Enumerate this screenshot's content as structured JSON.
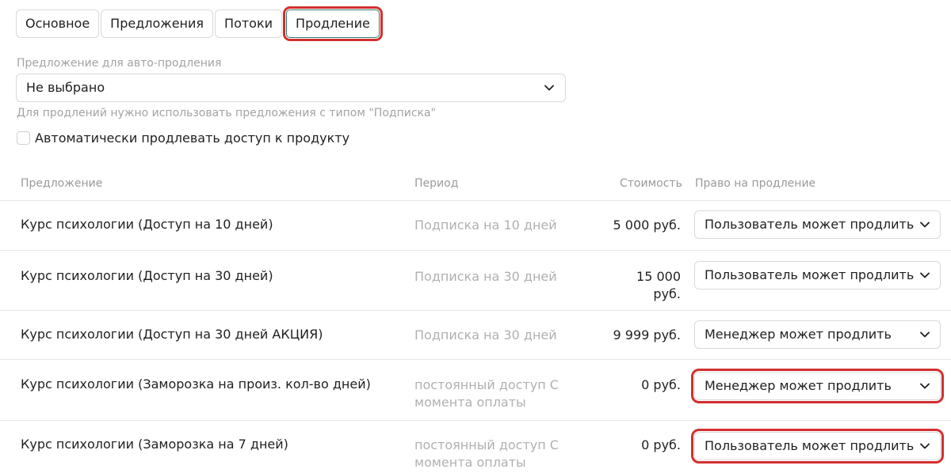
{
  "tabs": [
    {
      "label": "Основное",
      "active": false
    },
    {
      "label": "Предложения",
      "active": false
    },
    {
      "label": "Потоки",
      "active": false
    },
    {
      "label": "Продление",
      "active": true
    }
  ],
  "auto_renewal": {
    "label": "Предложение для авто-продления",
    "selected": "Не выбрано",
    "hint": "Для продлений нужно использовать предложения с типом \"Подписка\""
  },
  "auto_extend": {
    "label": "Автоматически продлевать доступ к продукту",
    "checked": false
  },
  "table": {
    "headers": {
      "offer": "Предложение",
      "period": "Период",
      "cost": "Стоимость",
      "right": "Право на продление"
    },
    "rows": [
      {
        "offer": "Курс психологии (Доступ на 10 дней)",
        "period": "Подписка на 10 дней",
        "cost": "5 000 руб.",
        "right": "Пользователь может продлить"
      },
      {
        "offer": "Курс психологии (Доступ на 30 дней)",
        "period": "Подписка на 30 дней",
        "cost": "15 000 руб.",
        "right": "Пользователь может продлить"
      },
      {
        "offer": "Курс психологии (Доступ на 30 дней АКЦИЯ)",
        "period": "Подписка на 30 дней",
        "cost": "9 999 руб.",
        "right": "Менеджер может продлить"
      },
      {
        "offer": "Курс психологии (Заморозка на произ. кол-во дней)",
        "period": "постоянный доступ С момента оплаты",
        "cost": "0 руб.",
        "right": "Менеджер может продлить"
      },
      {
        "offer": "Курс психологии (Заморозка на 7 дней)",
        "period": "постоянный доступ С момента оплаты",
        "cost": "0 руб.",
        "right": "Пользователь может продлить"
      }
    ]
  },
  "colors": {
    "highlight": "#d32f2f",
    "active_tab_border": "#2f7d6d",
    "muted_text": "#a3a3a3"
  }
}
